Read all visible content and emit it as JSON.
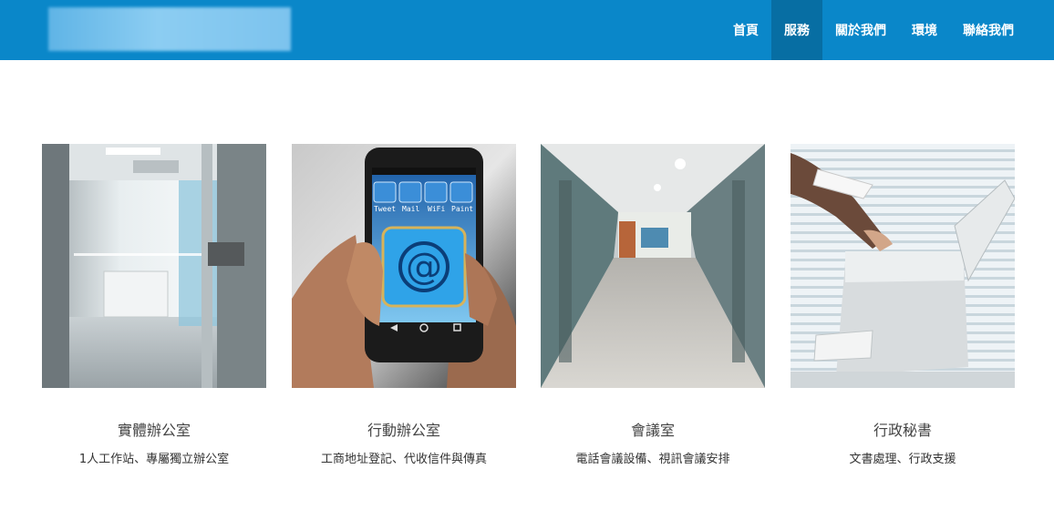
{
  "nav": {
    "items": [
      {
        "label": "首頁",
        "active": false
      },
      {
        "label": "服務",
        "active": true
      },
      {
        "label": "關於我們",
        "active": false
      },
      {
        "label": "環境",
        "active": false
      },
      {
        "label": "聯絡我們",
        "active": false
      }
    ]
  },
  "colors": {
    "header_bg": "#0a87c9",
    "active_nav_bg": "#076ea3"
  },
  "services": [
    {
      "title": "實體辦公室",
      "description": "1人工作站、專屬獨立辦公室",
      "image": "glass-door-office-photo"
    },
    {
      "title": "行動辦公室",
      "description": "工商地址登記、代收信件與傳真",
      "image": "smartphone-email-photo"
    },
    {
      "title": "會議室",
      "description": "電話會議設備、視訊會議安排",
      "image": "office-corridor-photo"
    },
    {
      "title": "行政秘書",
      "description": "文書處理、行政支援",
      "image": "printer-scanner-photo"
    }
  ],
  "phone_apps": [
    "Tweet",
    "Mail",
    "WiFi",
    "Paint"
  ]
}
